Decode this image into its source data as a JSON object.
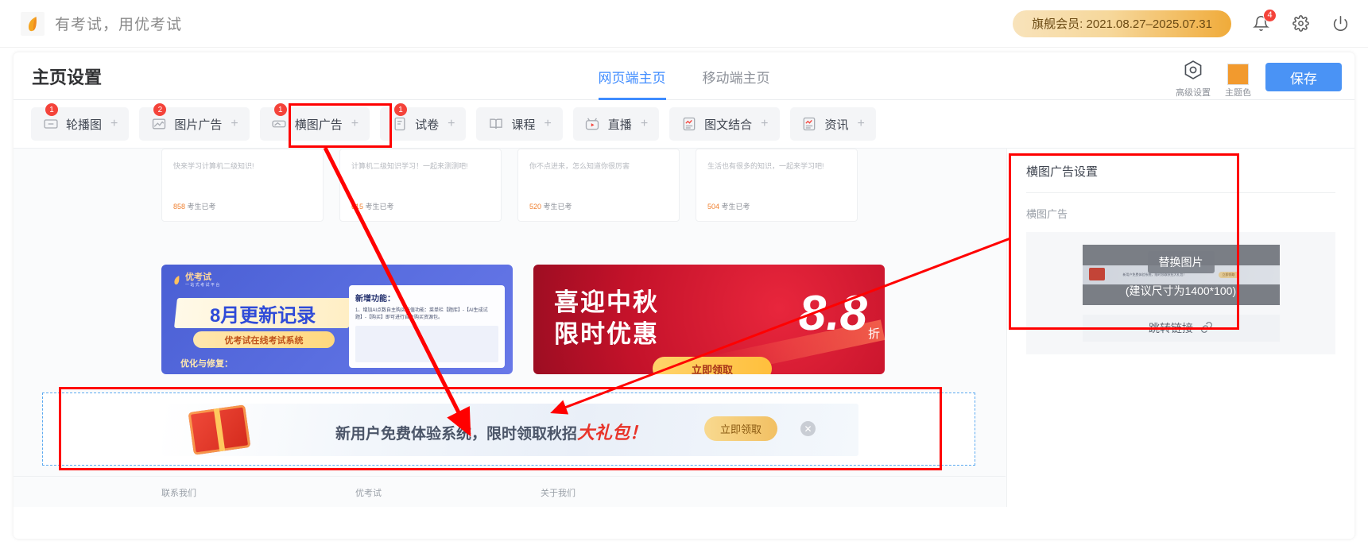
{
  "topbar": {
    "brand_title": "有考试，用优考试",
    "logo_icon": "leaf-logo-icon",
    "member_label": "旗舰会员: 2021.08.27–2025.07.31",
    "bell_icon": "bell-icon",
    "bell_badge": "4",
    "settings_icon": "gear-icon",
    "power_icon": "power-icon"
  },
  "page": {
    "title": "主页设置",
    "tabs": [
      {
        "label": "网页端主页",
        "active": true
      },
      {
        "label": "移动端主页",
        "active": false
      }
    ],
    "tools": {
      "advanced_icon": "hexagon-settings-icon",
      "advanced_label": "高级设置",
      "theme_label": "主题色",
      "theme_color": "#f29a2e",
      "save_label": "保存"
    }
  },
  "modules": [
    {
      "label": "轮播图",
      "badge": "1",
      "icon": "carousel-icon",
      "plus": "+",
      "selected": false
    },
    {
      "label": "图片广告",
      "badge": "2",
      "icon": "image-ad-icon",
      "plus": "+",
      "selected": false
    },
    {
      "label": "横图广告",
      "badge": "1",
      "icon": "banner-ad-icon",
      "plus": "+",
      "selected": true
    },
    {
      "label": "试卷",
      "badge": "1",
      "icon": "exam-paper-icon",
      "plus": "+",
      "selected": false
    },
    {
      "label": "课程",
      "badge": "",
      "icon": "book-icon",
      "plus": "+",
      "selected": false
    },
    {
      "label": "直播",
      "badge": "",
      "icon": "live-tv-icon",
      "plus": "+",
      "selected": false
    },
    {
      "label": "图文结合",
      "badge": "",
      "icon": "article-icon",
      "plus": "+",
      "selected": false
    },
    {
      "label": "资讯",
      "badge": "",
      "icon": "news-icon",
      "plus": "+",
      "selected": false
    }
  ],
  "canvas": {
    "exam_cards": [
      {
        "desc": "快来学习计算机二级知识!",
        "count": "858",
        "count_suffix": "考生已考"
      },
      {
        "desc": "计算机二级知识学习！一起来测测吧!",
        "count": "615",
        "count_suffix": "考生已考"
      },
      {
        "desc": "你不点进来，怎么知道你很厉害",
        "count": "520",
        "count_suffix": "考生已考"
      },
      {
        "desc": "生活也有很多的知识，一起来学习吧!",
        "count": "504",
        "count_suffix": "考生已考"
      }
    ],
    "banner_blue": {
      "logo_text": "优考试",
      "logo_sub": "一 站 式 考 试 平 台",
      "headline": "8月更新记录",
      "subhead": "优考试在线考试系统",
      "fix_label": "优化与修复：",
      "panel_title": "新增功能：",
      "panel_line": "1、增加AI点数自主购买充值功能：菜单栏【题库】-【AI生成试题】-【购买】即可进行自主购买资源包。"
    },
    "banner_red": {
      "line1": "喜迎中秋",
      "line2": "限时优惠",
      "discount": "8.8",
      "discount_unit": "折",
      "cta": "立即领取"
    },
    "selected_banner": {
      "text_plain": "新用户免费体验系统，限时领取秋招",
      "text_accent": "大礼包！",
      "button_label": "立即领取",
      "close_icon": "close-icon"
    },
    "footer": [
      "联系我们",
      "优考试",
      "关于我们"
    ]
  },
  "right_panel": {
    "title": "横图广告设置",
    "section_label": "横图广告",
    "replace_label": "替换图片",
    "size_hint": "(建议尺寸为1400*100)",
    "link_label": "跳转链接",
    "link_icon": "link-icon",
    "thumb_text": "新用户免费体验系统，限时领取秋招大礼包！",
    "thumb_button": "立即领取"
  },
  "annotations": {
    "highlight_color": "#ff0000",
    "selection_color": "#5ba9f0"
  }
}
